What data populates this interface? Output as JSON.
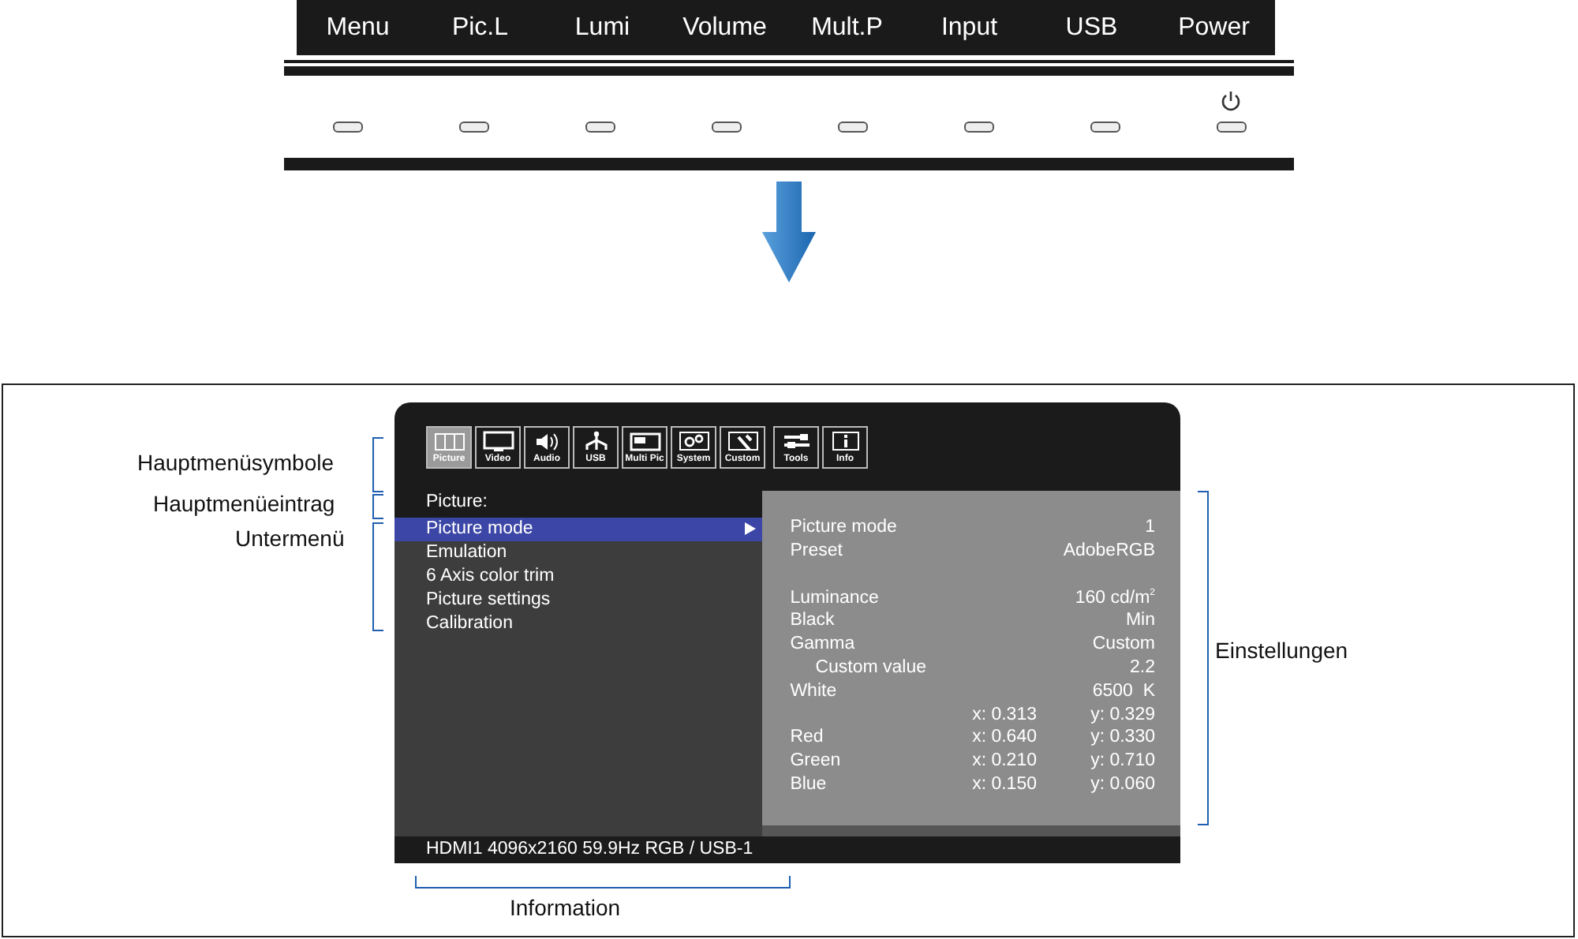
{
  "buttons": [
    {
      "label": "Menu",
      "kind": "plain"
    },
    {
      "label": "Pic.L",
      "kind": "plain"
    },
    {
      "label": "Lumi",
      "kind": "plain"
    },
    {
      "label": "Volume",
      "kind": "plain"
    },
    {
      "label": "Mult.P",
      "kind": "plain"
    },
    {
      "label": "Input",
      "kind": "plain"
    },
    {
      "label": "USB",
      "kind": "plain"
    },
    {
      "label": "Power",
      "kind": "power"
    }
  ],
  "osd": {
    "icon_groups": [
      [
        {
          "label": "Picture",
          "selected": true
        },
        {
          "label": "Video",
          "selected": false
        },
        {
          "label": "Audio",
          "selected": false
        },
        {
          "label": "USB",
          "selected": false
        },
        {
          "label": "Multi Pic",
          "selected": false
        },
        {
          "label": "System",
          "selected": false
        },
        {
          "label": "Custom",
          "selected": false
        }
      ],
      [
        {
          "label": "Tools",
          "selected": false
        },
        {
          "label": "Info",
          "selected": false
        }
      ]
    ],
    "section_title": "Picture:",
    "submenu": [
      {
        "label": "Picture mode",
        "selected": true
      },
      {
        "label": "Emulation",
        "selected": false
      },
      {
        "label": "6 Axis color trim",
        "selected": false
      },
      {
        "label": "Picture settings",
        "selected": false
      },
      {
        "label": "Calibration",
        "selected": false
      }
    ],
    "settings": [
      [
        {
          "label": "Picture mode",
          "value": "1"
        },
        {
          "label": "Preset",
          "value": "AdobeRGB"
        }
      ],
      [
        {
          "label": "Luminance",
          "value": "160 cd/m$^{2}$"
        },
        {
          "label": "Black",
          "value": "Min"
        },
        {
          "label": "Gamma",
          "value": "Custom",
          "children": [
            {
              "label": "Custom value",
              "value": "2.2"
            }
          ]
        },
        {
          "label": "White",
          "value": "6500  K"
        },
        {
          "x": "x: 0.313",
          "value": "y: 0.329"
        },
        {
          "label": "Red",
          "x": "x: 0.640",
          "value": "y: 0.330"
        },
        {
          "label": "Green",
          "x": "x: 0.210",
          "value": "y: 0.710"
        },
        {
          "label": "Blue",
          "x": "x: 0.150",
          "value": "y: 0.060"
        }
      ]
    ],
    "info": "HDMI1 4096x2160 59.9Hz RGB / USB-1"
  },
  "annotations": {
    "icons": "Hauptmenüsymbole",
    "entry": "Hauptmenüeintrag",
    "submenu": "Untermenü",
    "settings": "Einstellungen",
    "info": "Information"
  }
}
